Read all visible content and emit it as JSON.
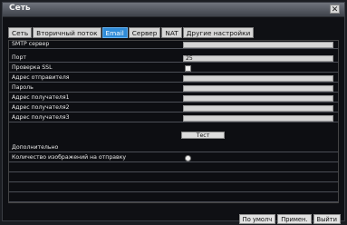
{
  "window": {
    "title": "Сеть",
    "close_glyph": "✕"
  },
  "tabs": [
    {
      "label": "Сеть",
      "active": false
    },
    {
      "label": "Вторичный поток",
      "active": false
    },
    {
      "label": "Email",
      "active": true
    },
    {
      "label": "Сервер",
      "active": false
    },
    {
      "label": "NAT",
      "active": false
    },
    {
      "label": "Другие настройки",
      "active": false
    }
  ],
  "form": {
    "smtp_server": {
      "label": "SMTP сервер",
      "value": ""
    },
    "port": {
      "label": "Порт",
      "value": "25"
    },
    "ssl": {
      "label": "Проверка SSL",
      "checked": false
    },
    "sender": {
      "label": "Адрес отправителя",
      "value": ""
    },
    "password": {
      "label": "Пароль",
      "value": ""
    },
    "recipient1": {
      "label": "Адрес получателя1",
      "value": ""
    },
    "recipient2": {
      "label": "Адрес получателя2",
      "value": ""
    },
    "recipient3": {
      "label": "Адрес получателя3",
      "value": ""
    },
    "test_button": "Тест",
    "advanced_label": "Дополнительно",
    "images_count": {
      "label": "Количество изображений на отправку",
      "checked": false
    }
  },
  "footer": {
    "default_button": "По умолч",
    "apply_button": "Примен.",
    "exit_button": "Выйти"
  },
  "colors": {
    "active_tab": "#2f8bd8",
    "background": "#0d0e12",
    "field": "#d5d5d5"
  }
}
